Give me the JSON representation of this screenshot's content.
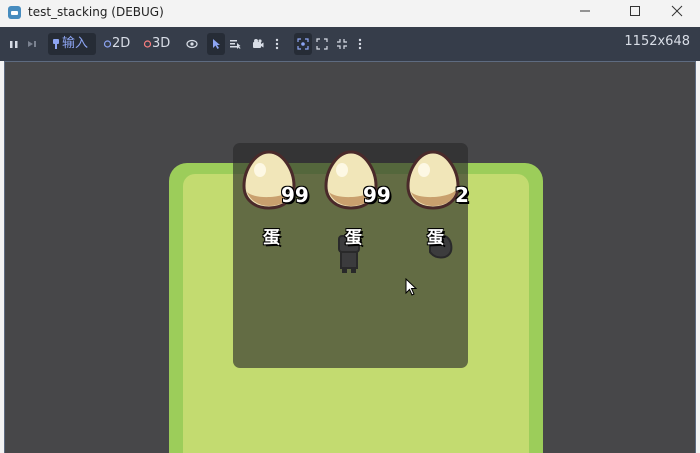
{
  "window": {
    "title": "test_stacking (DEBUG)"
  },
  "toolbar": {
    "input_label": "输入",
    "mode_2d": "2D",
    "mode_3d": "3D",
    "resolution": "1152x648"
  },
  "inventory": {
    "slots": [
      {
        "name": "蛋",
        "count": "99"
      },
      {
        "name": "蛋",
        "count": "99"
      },
      {
        "name": "蛋",
        "count": "2"
      }
    ]
  },
  "colors": {
    "toolbar_bg": "#363d4a",
    "viewport_bg": "#474749",
    "grass": "#c3db70",
    "accent_2d": "#8da5f3",
    "accent_3d": "#fc7f7f"
  }
}
